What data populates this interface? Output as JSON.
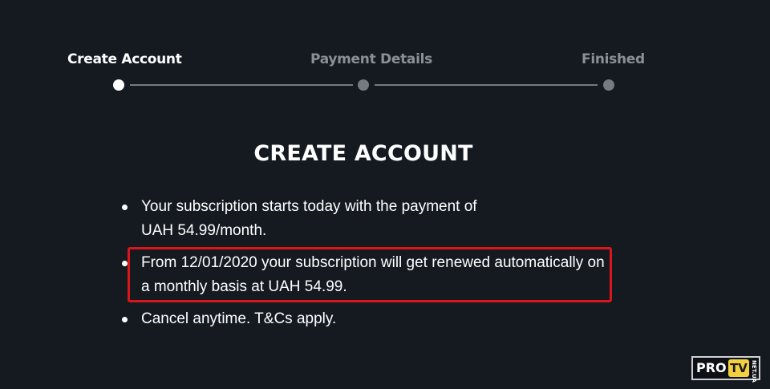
{
  "stepper": {
    "steps": [
      {
        "label": "Create Account",
        "state": "active"
      },
      {
        "label": "Payment Details",
        "state": "inactive"
      },
      {
        "label": "Finished",
        "state": "inactive"
      }
    ]
  },
  "main": {
    "heading": "CREATE ACCOUNT",
    "bullets": [
      {
        "line1": "Your subscription starts today with the payment of",
        "line2": "UAH 54.99/month."
      },
      {
        "line1": "From 12/01/2020 your subscription will get renewed automatically on",
        "line2": "a monthly basis at UAH 54.99."
      },
      {
        "line1": "Cancel anytime. T&Cs apply.",
        "line2": ""
      }
    ]
  },
  "watermark": {
    "pro": "PRO",
    "tv": "TV",
    "net": "NET.UA"
  },
  "colors": {
    "background": "#141a20",
    "highlight_border": "#d9161c",
    "inactive": "#767b82"
  }
}
